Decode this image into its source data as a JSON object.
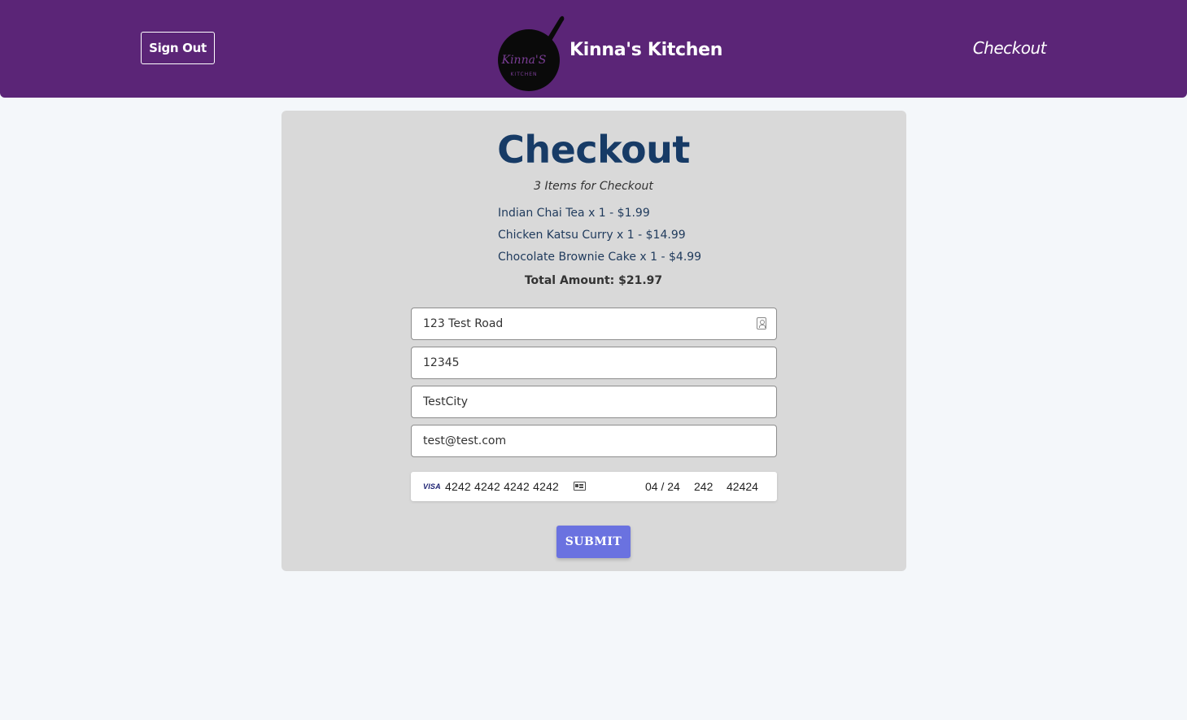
{
  "header": {
    "sign_out_label": "Sign Out",
    "brand_name": "Kinna's Kitchen",
    "logo_text": "Kinna'S",
    "logo_subtext": "KITCHEN",
    "nav_checkout_label": "Checkout"
  },
  "checkout": {
    "title": "Checkout",
    "subtitle": "3 Items for Checkout",
    "items": [
      {
        "text": "Indian Chai Tea x 1 - $1.99"
      },
      {
        "text": "Chicken Katsu Curry x 1 - $14.99"
      },
      {
        "text": "Chocolate Brownie Cake x 1 - $4.99"
      }
    ],
    "total": "Total Amount: $21.97"
  },
  "form": {
    "address": "123 Test Road",
    "zip": "12345",
    "city": "TestCity",
    "email": "test@test.com"
  },
  "card": {
    "brand": "VISA",
    "number": "4242 4242 4242 4242",
    "expiry": "04 / 24",
    "cvc": "242",
    "postal": "42424"
  },
  "submit_label": "SUBMIT",
  "colors": {
    "header_bg": "#5b2577",
    "card_bg": "#d9d9d9",
    "title": "#173b66",
    "submit_bg": "#6a72e0",
    "page_bg": "#f4f7fa"
  }
}
